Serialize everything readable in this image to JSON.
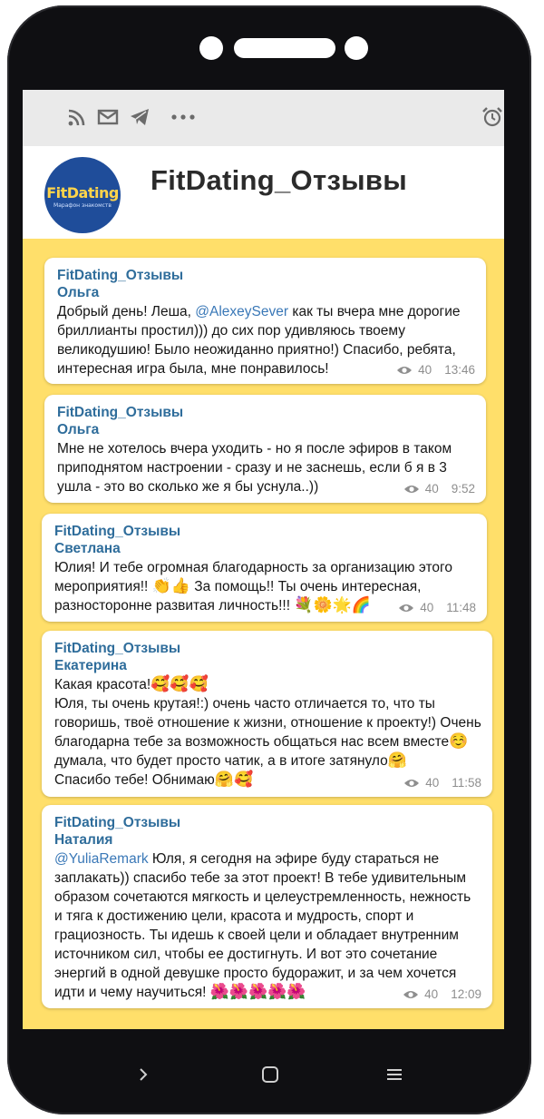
{
  "topbar": {
    "icons": [
      "rss-icon",
      "mail-icon",
      "telegram-icon",
      "more-icon",
      "alarm-icon"
    ]
  },
  "header": {
    "title": "FitDating_Отзывы",
    "avatar_logo_main": "FitDating",
    "avatar_logo_sub": "Марафон знакомств"
  },
  "messages": [
    {
      "channel": "FitDating_Отзывы",
      "author": "Ольга",
      "text_before": "Добрый день! Леша, ",
      "mention": "@AlexeySever",
      "text_after": "     как ты вчера мне дорогие бриллианты простил))) до сих пор удивляюсь твоему великодушию! Было неожиданно приятно!) Спасибо, ребята, интересная игра была, мне понравилось!",
      "views": "40",
      "time": "13:46"
    },
    {
      "channel": "FitDating_Отзывы",
      "author": "Ольга",
      "text": "Мне не хотелось вчера уходить - но я после эфиров в таком приподнятом настроении - сразу и не заснешь, если б я в 3 ушла - это во сколько же я бы уснула..))",
      "views": "40",
      "time": "9:52"
    },
    {
      "channel": "FitDating_Отзывы",
      "author": "Светлана",
      "text_a": "Юлия! И тебе огромная благодарность за организацию этого мероприятия!!  ",
      "emoji_a": "👏👍",
      "text_b": " За помощь!! Ты очень интересная, разносторонне развитая личность!!! ",
      "emoji_b": "💐🌼🌟🌈",
      "views": "40",
      "time": "11:48"
    },
    {
      "channel": "FitDating_Отзывы",
      "author": "Екатерина",
      "line1": "Какая красота!",
      "emoji1": "🥰🥰🥰",
      "text_a": "Юля, ты очень крутая!:) очень часто отличается то, что ты говоришь, твоё отношение к жизни, отношение к проекту!) Очень благодарна тебе за возможность общаться нас всем вместе",
      "emoji2": "☺️",
      "text_b": " думала, что будет просто чатик, а в итоге затянуло",
      "emoji3": "🤗",
      "text_c": "Спасибо тебе! Обнимаю",
      "emoji4": "🤗🥰",
      "views": "40",
      "time": "11:58"
    },
    {
      "channel": "FitDating_Отзывы",
      "author": "Наталия",
      "mention": "@YuliaRemark",
      "text": " Юля, я сегодня на эфире буду стараться не заплакать)) спасибо тебе за этот проект! В тебе удивительным образом сочетаются мягкость и целеустремленность, нежность и тяга к достижению цели, красота и мудрость, спорт и грациозность. Ты идешь к своей цели и обладает внутренним источником сил, чтобы ее достигнуть. И вот это сочетание энергий в одной девушке просто будоражит, и за чем хочется идти и чему научиться! ",
      "emoji": "🌺🌺🌺🌺🌺",
      "views": "40",
      "time": "12:09"
    }
  ],
  "navbar": {
    "icons": [
      "back-icon",
      "home-icon",
      "menu-icon"
    ]
  }
}
